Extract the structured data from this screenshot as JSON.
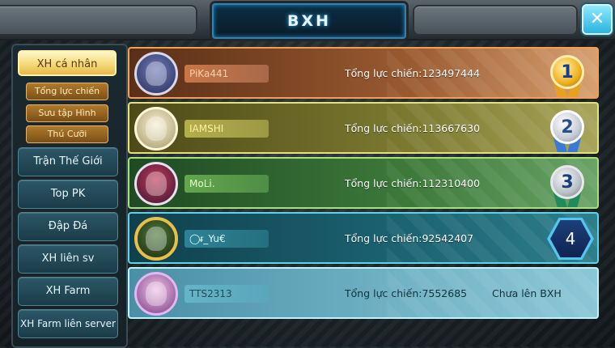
{
  "header": {
    "title": "BXH",
    "close_icon": "close-icon"
  },
  "sidebar": {
    "active_tab": "XH cá nhân",
    "subtabs": [
      "Tổng lực chiến",
      "Sưu tập Hình",
      "Thú Cưỡi"
    ],
    "nav": [
      "Trận Thế Giới",
      "Top PK",
      "Đập Đá",
      "XH liên sv",
      "XH Farm",
      "XH Farm liên server"
    ]
  },
  "rankings": [
    {
      "name": "PiKa441",
      "power_label": "Tổng lực chiến:",
      "power": "123497444",
      "rank": "1",
      "medal": "gold"
    },
    {
      "name": "IAMSHI",
      "power_label": "Tổng lực chiến:",
      "power": "113667630",
      "rank": "2",
      "medal": "silver"
    },
    {
      "name": "MoLi.",
      "power_label": "Tổng lực chiến:",
      "power": "112310400",
      "rank": "3",
      "medal": "bronze"
    },
    {
      "name": "◯ᵲ_Yu€",
      "power_label": "Tổng lực chiến:",
      "power": "92542407",
      "rank": "4",
      "medal": "hex"
    },
    {
      "name": "TTS2313",
      "power_label": "Tổng lực chiến:",
      "power": "7552685",
      "rank_text": "Chưa lên BXH"
    }
  ],
  "colors": {
    "accent": "#29a8ff",
    "gold": "#f0b020",
    "active_tab": "#f5d97a"
  }
}
